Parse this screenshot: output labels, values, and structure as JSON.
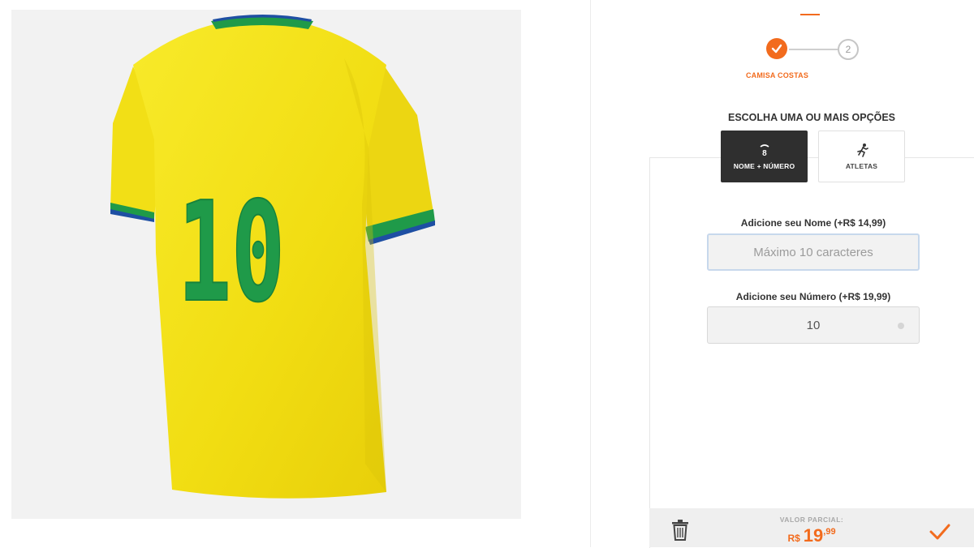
{
  "stepper": {
    "step1_label": "CAMISA COSTAS",
    "step2_number": "2"
  },
  "options": {
    "title": "ESCOLHA UMA OU MAIS OPÇÕES",
    "name_number": {
      "label": "NOME + NÚMERO",
      "icon": "jersey-icon",
      "icon_glyph": "8"
    },
    "athletes": {
      "label": "ATLETAS",
      "icon": "runner-icon"
    }
  },
  "fields": {
    "name_label": "Adicione seu Nome (+R$ 14,99)",
    "name_placeholder": "Máximo 10 caracteres",
    "name_value": "",
    "number_label": "Adicione seu Número (+R$ 19,99)",
    "number_value": "10"
  },
  "product": {
    "jersey_number": "10"
  },
  "summary": {
    "partial_label": "VALOR PARCIAL:",
    "currency": "R$",
    "price_integer": "19",
    "price_decimal": ",99"
  },
  "colors": {
    "accent": "#f26b1d",
    "jersey_yellow": "#f5e21a",
    "jersey_green": "#1f9a49",
    "selected_option_bg": "#2f2f2f"
  }
}
